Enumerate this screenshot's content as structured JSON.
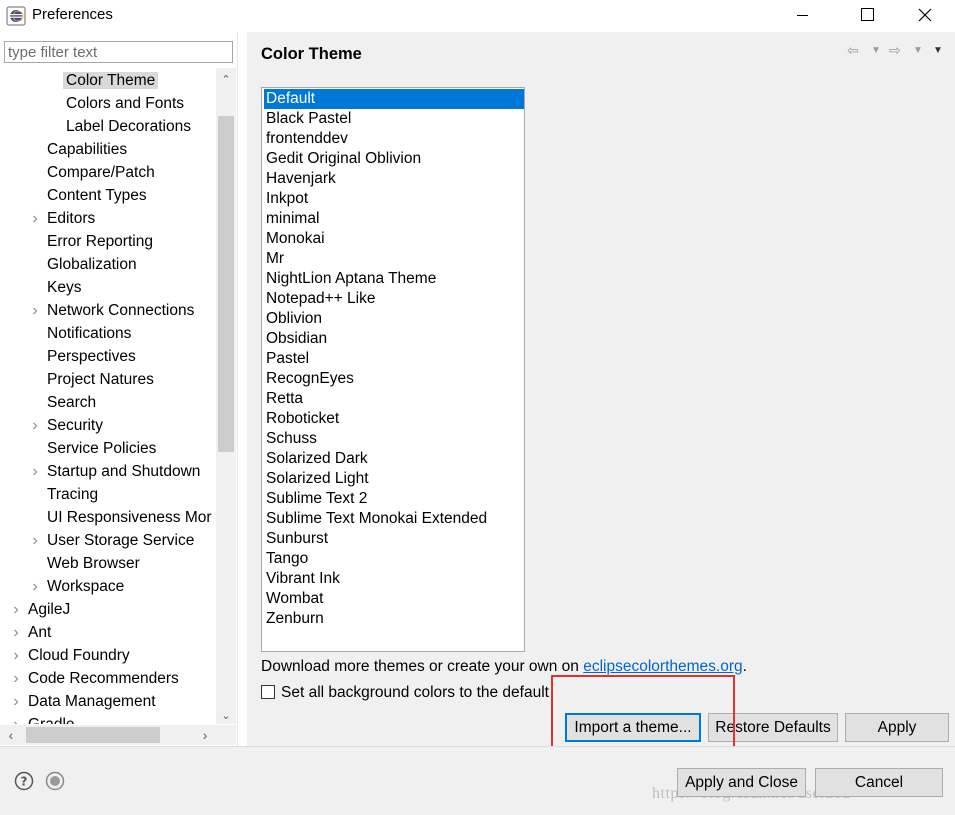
{
  "window": {
    "title": "Preferences"
  },
  "filter": {
    "placeholder": "type filter text",
    "value": ""
  },
  "tree": {
    "items": [
      {
        "label": "Color Theme",
        "level": 2,
        "selected": true
      },
      {
        "label": "Colors and Fonts",
        "level": 2
      },
      {
        "label": "Label Decorations",
        "level": 2
      },
      {
        "label": "Capabilities",
        "level": 1
      },
      {
        "label": "Compare/Patch",
        "level": 1
      },
      {
        "label": "Content Types",
        "level": 1
      },
      {
        "label": "Editors",
        "level": 1,
        "expandable": true
      },
      {
        "label": "Error Reporting",
        "level": 1
      },
      {
        "label": "Globalization",
        "level": 1
      },
      {
        "label": "Keys",
        "level": 1
      },
      {
        "label": "Network Connections",
        "level": 1,
        "expandable": true
      },
      {
        "label": "Notifications",
        "level": 1
      },
      {
        "label": "Perspectives",
        "level": 1
      },
      {
        "label": "Project Natures",
        "level": 1
      },
      {
        "label": "Search",
        "level": 1
      },
      {
        "label": "Security",
        "level": 1,
        "expandable": true
      },
      {
        "label": "Service Policies",
        "level": 1
      },
      {
        "label": "Startup and Shutdown",
        "level": 1,
        "expandable": true
      },
      {
        "label": "Tracing",
        "level": 1
      },
      {
        "label": "UI Responsiveness Mor",
        "level": 1
      },
      {
        "label": "User Storage Service",
        "level": 1,
        "expandable": true
      },
      {
        "label": "Web Browser",
        "level": 1
      },
      {
        "label": "Workspace",
        "level": 1,
        "expandable": true
      },
      {
        "label": "AgileJ",
        "level": 0,
        "expandable": true
      },
      {
        "label": "Ant",
        "level": 0,
        "expandable": true
      },
      {
        "label": "Cloud Foundry",
        "level": 0,
        "expandable": true
      },
      {
        "label": "Code Recommenders",
        "level": 0,
        "expandable": true
      },
      {
        "label": "Data Management",
        "level": 0,
        "expandable": true
      },
      {
        "label": "Gradle",
        "level": 0,
        "expandable": true
      }
    ]
  },
  "page": {
    "title": "Color Theme",
    "themes": [
      "Default",
      "Black Pastel",
      "frontenddev",
      "Gedit Original Oblivion",
      "Havenjark",
      "Inkpot",
      "minimal",
      "Monokai",
      "Mr",
      "NightLion Aptana Theme",
      "Notepad++ Like",
      "Oblivion",
      "Obsidian",
      "Pastel",
      "RecognEyes",
      "Retta",
      "Roboticket",
      "Schuss",
      "Solarized Dark",
      "Solarized Light",
      "Sublime Text 2",
      "Sublime Text Monokai Extended",
      "Sunburst",
      "Tango",
      "Vibrant Ink",
      "Wombat",
      "Zenburn"
    ],
    "selected_theme": "Default",
    "download_text": "Download more themes or create your own on ",
    "download_link": "eclipsecolorthemes.org",
    "download_suffix": ".",
    "checkbox_label": "Set all background colors to the default",
    "checkbox_checked": false,
    "import_button": "Import a theme...",
    "restore_button": "Restore Defaults",
    "apply_button": "Apply"
  },
  "footer": {
    "apply_close_button": "Apply and Close",
    "cancel_button": "Cancel",
    "watermark": "https://blog.csdn.net/userzou"
  },
  "colors": {
    "selection": "#0078d7",
    "tree_selection": "#d9d9d9",
    "link": "#0066cc",
    "highlight_box": "#e03232",
    "dialog_bg": "#f0f0f0"
  }
}
